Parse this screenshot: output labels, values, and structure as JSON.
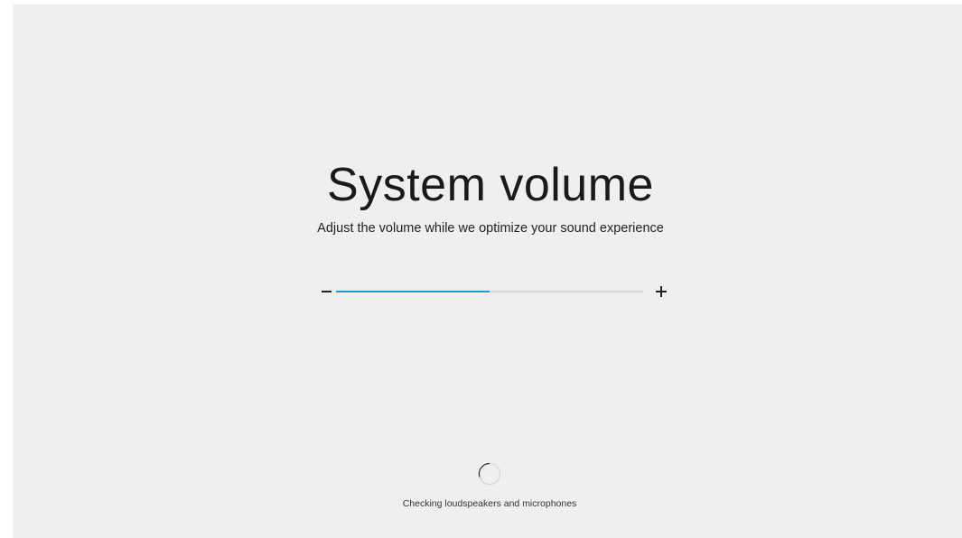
{
  "title": "System volume",
  "subtitle": "Adjust the volume while we optimize your sound experience",
  "volume": {
    "level": 0.5,
    "accent_color": "#1e9ad6",
    "track_color": "#d8d8d8",
    "decrease_icon": "minus-icon",
    "increase_icon": "plus-icon"
  },
  "status": {
    "icon": "spinner-icon",
    "text": "Checking loudspeakers and microphones"
  },
  "background_color": "#efefef"
}
